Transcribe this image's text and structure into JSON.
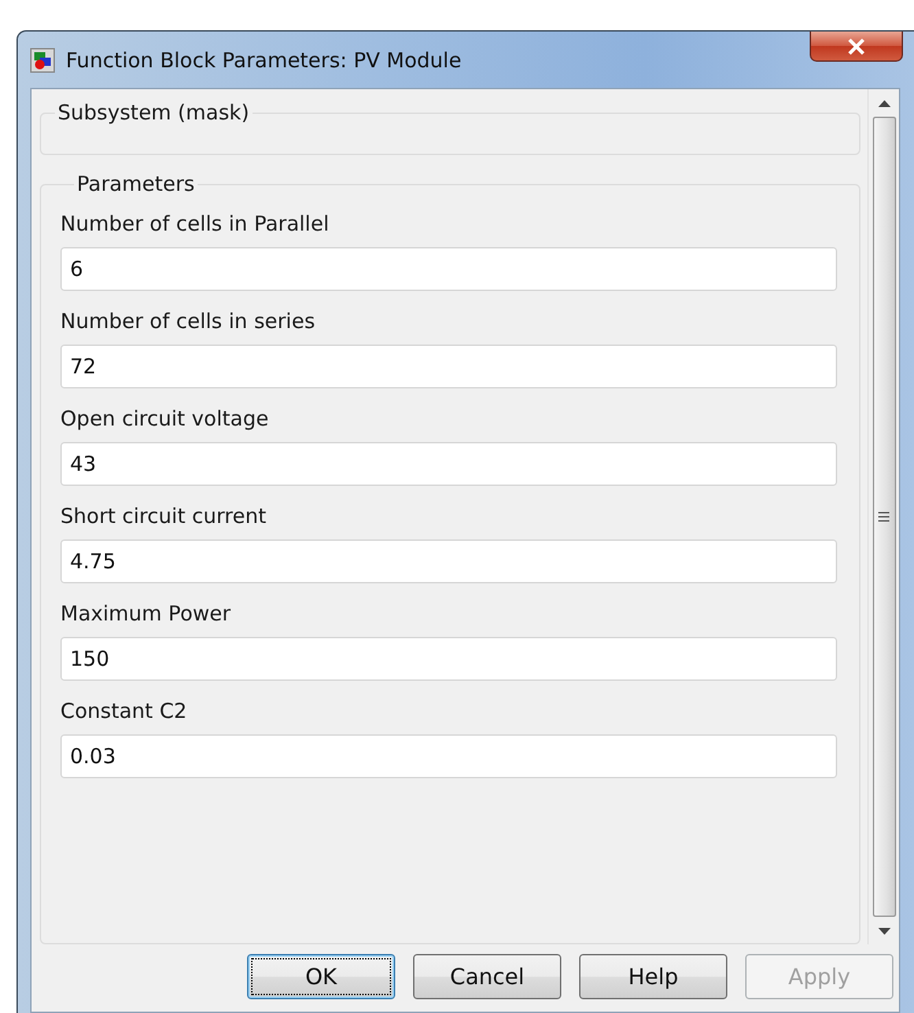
{
  "window": {
    "title": "Function Block Parameters: PV Module"
  },
  "description_group": {
    "title": "Subsystem (mask)"
  },
  "parameters_group": {
    "title": "Parameters",
    "fields": [
      {
        "label": "Number of cells in Parallel",
        "value": "6"
      },
      {
        "label": "Number of cells in series",
        "value": "72"
      },
      {
        "label": "Open circuit voltage",
        "value": "43"
      },
      {
        "label": "Short circuit current",
        "value": "4.75"
      },
      {
        "label": "Maximum Power",
        "value": "150"
      },
      {
        "label": "Constant C2",
        "value": "0.03"
      }
    ]
  },
  "buttons": [
    {
      "label": "OK",
      "focused": true,
      "disabled": false
    },
    {
      "label": "Cancel",
      "focused": false,
      "disabled": false
    },
    {
      "label": "Help",
      "focused": false,
      "disabled": false
    },
    {
      "label": "Apply",
      "focused": false,
      "disabled": true
    }
  ]
}
